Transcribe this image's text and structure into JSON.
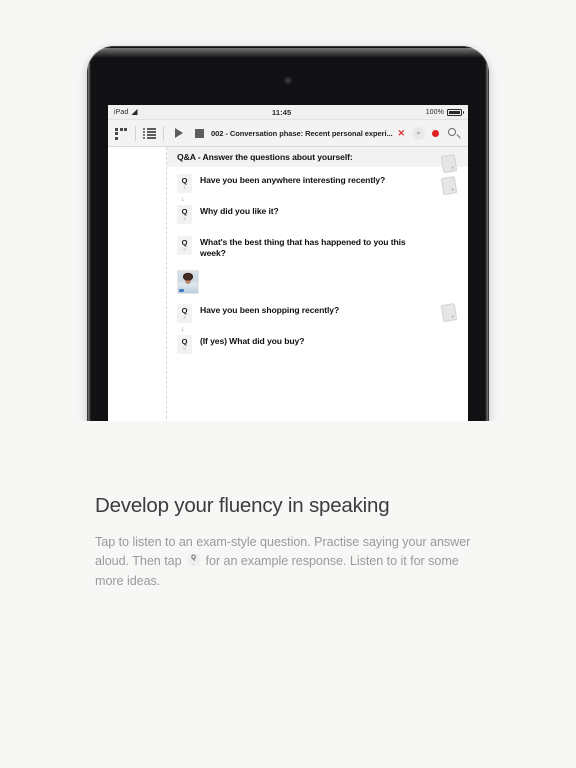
{
  "device": {
    "status_bar": {
      "carrier": "iPad",
      "wifi_icon": "wifi-icon",
      "time": "11:45",
      "battery_percent": "100%"
    },
    "toolbar": {
      "grid_view_icon": "grid-view-icon",
      "list_view_icon": "list-view-icon",
      "play_icon": "play-icon",
      "stop_icon": "stop-icon",
      "track_title": "002 - Conversation phase: Recent personal experi...",
      "cancel_icon": "close-x-icon",
      "playback_icon": "play-small-icon",
      "record_icon": "record-dot-icon",
      "search_icon": "search-icon"
    },
    "content": {
      "section_header": "Q&A - Answer the questions about yourself:",
      "questions": [
        {
          "badge_letter": "Q",
          "badge_number": "1",
          "text": "Have you been anywhere interesting recently?",
          "arrow": "↓",
          "has_note": true
        },
        {
          "badge_letter": "Q",
          "badge_number": "2",
          "text": "Why did you like it?",
          "arrow": "",
          "has_note": false
        },
        {
          "badge_letter": "Q",
          "badge_number": "3",
          "text": "What's the best thing that has happened to you this week?",
          "arrow": "",
          "has_note": false
        },
        {
          "badge_letter": "Q",
          "badge_number": "4",
          "text": "Have you been shopping recently?",
          "arrow": "↓",
          "has_note": true
        },
        {
          "badge_letter": "Q",
          "badge_number": "5",
          "text": "(If yes) What did you buy?",
          "arrow": "",
          "has_note": false
        }
      ],
      "avatar_alt": "child-photo-thumbnail"
    }
  },
  "caption": {
    "heading": "Develop your fluency in speaking",
    "body_part1": "Tap to listen to an exam-style question. Practise saying your answer aloud. Then tap",
    "inline_badge_letter": "Q",
    "inline_badge_number": "1",
    "body_part2": "for an example response. Listen to it for some more ideas."
  },
  "colors": {
    "page_background": "#f7f7f6",
    "device_body": "#111113",
    "record_red": "#e02020",
    "cancel_red": "#e03131",
    "heading_text": "#3c3c3c",
    "body_text": "#9a9a9a"
  }
}
